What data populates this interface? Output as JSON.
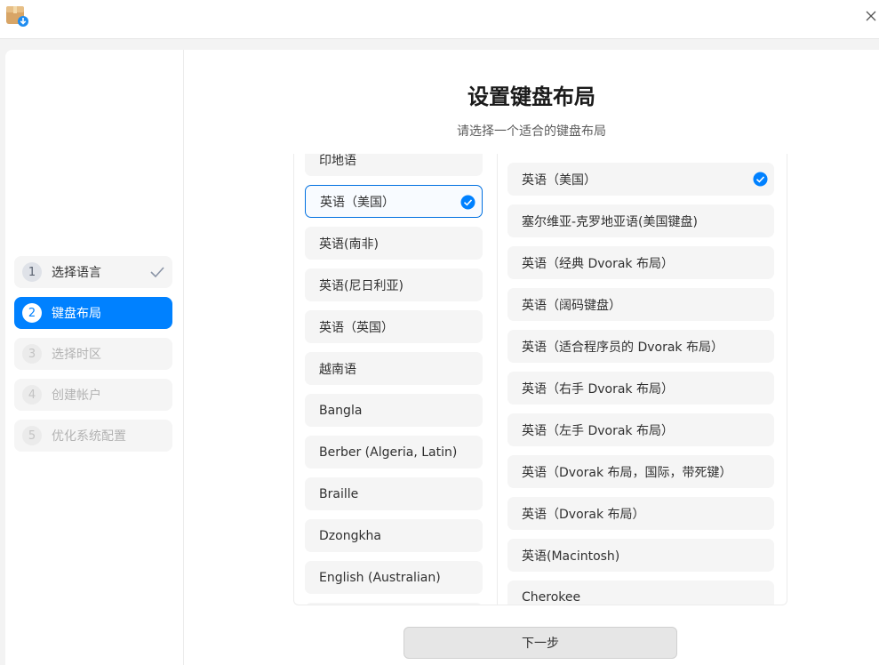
{
  "app": {
    "icon": "package-install-icon"
  },
  "titlebar": {
    "close_icon": "close-icon"
  },
  "steps": [
    {
      "num": "1",
      "label": "选择语言",
      "state": "done"
    },
    {
      "num": "2",
      "label": "键盘布局",
      "state": "active"
    },
    {
      "num": "3",
      "label": "选择时区",
      "state": "disabled"
    },
    {
      "num": "4",
      "label": "创建帐户",
      "state": "disabled"
    },
    {
      "num": "5",
      "label": "优化系统配置",
      "state": "disabled"
    }
  ],
  "main": {
    "title": "设置键盘布局",
    "subtitle": "请选择一个适合的键盘布局",
    "next_label": "下一步"
  },
  "languages": [
    "印地语",
    "英语（美国）",
    "英语(南非)",
    "英语(尼日利亚)",
    "英语（英国）",
    "越南语",
    "Bangla",
    "Berber (Algeria, Latin)",
    "Braille",
    "Dzongkha",
    "English (Australian)",
    ""
  ],
  "selected_language": "英语（美国）",
  "variants": [
    "英语（美国）",
    "塞尔维亚-克罗地亚语(美国键盘)",
    "英语（经典 Dvorak 布局）",
    "英语（阔码键盘）",
    "英语（适合程序员的 Dvorak 布局）",
    "英语（右手 Dvorak 布局）",
    "英语（左手 Dvorak 布局）",
    "英语（Dvorak 布局，国际，带死键）",
    "英语（Dvorak 布局）",
    "英语(Macintosh)",
    "Cherokee"
  ],
  "selected_variant": "英语（美国）",
  "colors": {
    "accent": "#0081ff",
    "selected_border": "#0070e0"
  }
}
